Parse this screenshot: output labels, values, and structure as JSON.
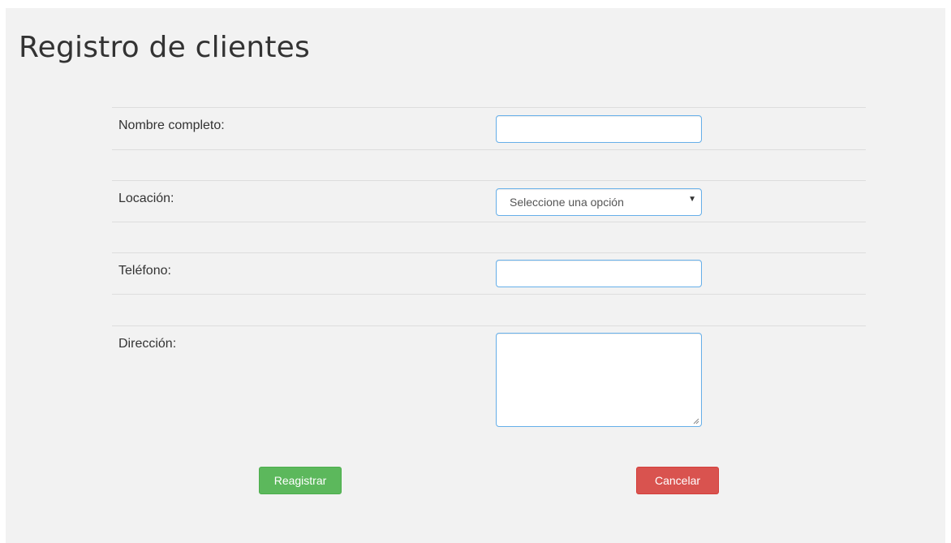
{
  "page": {
    "title": "Registro de clientes"
  },
  "form": {
    "fields": [
      {
        "label": "Nombre completo:",
        "value": ""
      },
      {
        "label": "Locación:",
        "selected": "Seleccione una opción"
      },
      {
        "label": "Teléfono:",
        "value": ""
      },
      {
        "label": "Dirección:",
        "value": ""
      }
    ]
  },
  "actions": {
    "submit_label": "Reagistrar",
    "cancel_label": "Cancelar"
  },
  "colors": {
    "background": "#f2f2f2",
    "input_border": "#66afe9",
    "success": "#5cb85c",
    "danger": "#d9534f"
  },
  "icons": {
    "select_arrow": "caret-down-icon",
    "textarea_resize": "resize-grip-icon"
  }
}
